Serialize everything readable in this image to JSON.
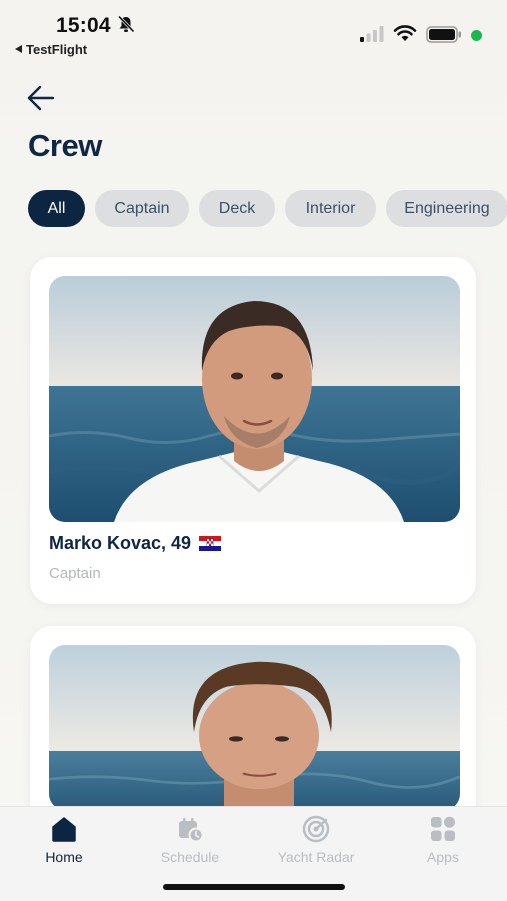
{
  "status_bar": {
    "time": "15:04",
    "back_app": "TestFlight"
  },
  "header": {
    "title": "Crew"
  },
  "filters": [
    {
      "label": "All",
      "active": true
    },
    {
      "label": "Captain",
      "active": false
    },
    {
      "label": "Deck",
      "active": false
    },
    {
      "label": "Interior",
      "active": false
    },
    {
      "label": "Engineering",
      "active": false
    }
  ],
  "crew": [
    {
      "name": "Marko Kovac, 49",
      "role": "Captain",
      "flag": "croatia"
    },
    {
      "name": "",
      "role": "",
      "flag": ""
    }
  ],
  "tabs": [
    {
      "label": "Home",
      "icon": "home-icon",
      "active": true
    },
    {
      "label": "Schedule",
      "icon": "calendar-clock-icon",
      "active": false
    },
    {
      "label": "Yacht Radar",
      "icon": "radar-icon",
      "active": false
    },
    {
      "label": "Apps",
      "icon": "apps-grid-icon",
      "active": false
    }
  ],
  "colors": {
    "accent": "#0c2540",
    "chip_bg": "#dcdedf",
    "inactive_tab": "#b9bec3",
    "green_dot": "#1db84b"
  }
}
